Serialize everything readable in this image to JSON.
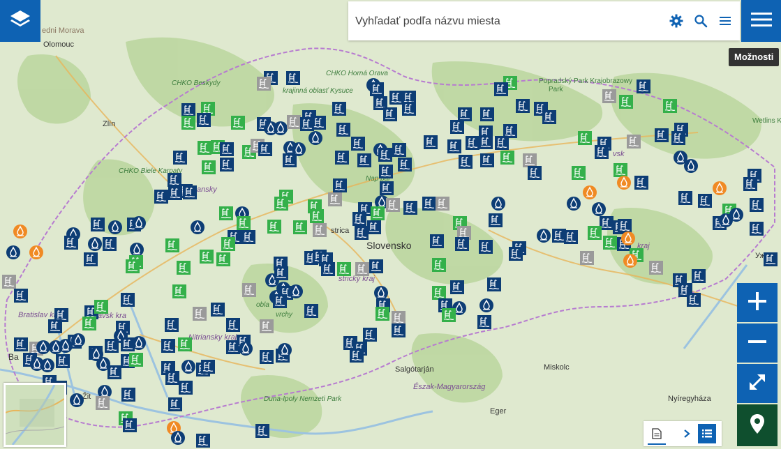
{
  "search": {
    "placeholder": "Vyhľadať podľa názvu miesta"
  },
  "tooltip": {
    "text": "Možnosti"
  },
  "icons": {
    "layers": "layers-icon",
    "settings": "gear-icon",
    "search": "search-icon",
    "list": "list-icon",
    "menu": "hamburger-menu-icon",
    "zoom_in": "plus-icon",
    "zoom_out": "minus-icon",
    "fullscreen": "expand-icon",
    "locate": "location-pin-icon",
    "document": "document-icon",
    "chevron": "chevron-right-icon",
    "list_view": "list-view-icon"
  },
  "colors": {
    "accent": "#0e62b3",
    "locate": "#0f4f2e",
    "marker_blue": "#0d3d75",
    "marker_green": "#34b04a",
    "marker_gray": "#9a9a9a",
    "marker_orange": "#f08a24",
    "marker_lightgreen": "#6bc04b"
  },
  "map": {
    "places": [
      {
        "text": "Slovensko"
      },
      {
        "text": "Zlín"
      },
      {
        "text": "Olomouc"
      },
      {
        "text": "edni Morava"
      },
      {
        "text": "CHKO Beskydy"
      },
      {
        "text": "CHKO Biele Karpaty"
      },
      {
        "text": "CHKO Horná Orava"
      },
      {
        "text": "krajinná oblasť Kysuce"
      },
      {
        "text": "Popradský Park Krajobrazowy"
      },
      {
        "text": "Bratislav kra"
      },
      {
        "text": "avsk kra"
      },
      {
        "text": "Nitriansky kraj"
      },
      {
        "text": "strický kraj"
      },
      {
        "text": "Salgótarján"
      },
      {
        "text": "Észak-Magyarország"
      },
      {
        "text": "Miskolc"
      },
      {
        "text": "Nyíregyháza"
      },
      {
        "text": "Eger"
      },
      {
        "text": "Ужгор"
      },
      {
        "text": "Duna-Ipoly Nemzeti Park"
      },
      {
        "text": "Žit"
      },
      {
        "text": "Ba"
      },
      {
        "text": "strica"
      },
      {
        "text": "Nap par"
      },
      {
        "text": "Wetlins Krajob"
      },
      {
        "text": "Park"
      },
      {
        "text": "vrchy"
      },
      {
        "text": "obla"
      },
      {
        "text": "ansky"
      },
      {
        "text": "vsk"
      },
      {
        "text": "kraj"
      }
    ]
  }
}
